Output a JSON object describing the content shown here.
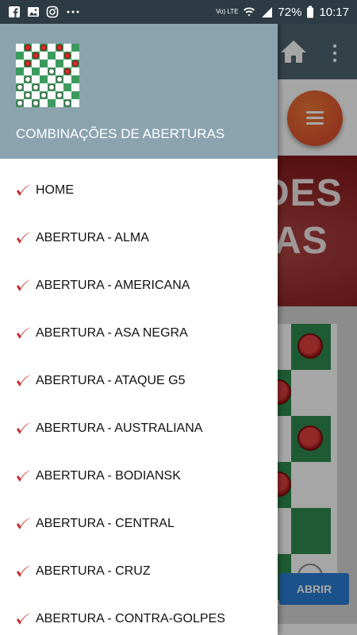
{
  "status_bar": {
    "left_icons": [
      "facebook-icon",
      "gallery-icon",
      "instagram-icon",
      "more-notifications-icon"
    ],
    "network": "Vo) LTE",
    "battery": "72%",
    "time": "10:17"
  },
  "background_app": {
    "banner_text_1": "DES",
    "banner_text_2": "AS",
    "open_button": "ABRIR"
  },
  "drawer": {
    "title": "COMBINAÇÕES DE ABERTURAS",
    "items": [
      {
        "label": "HOME"
      },
      {
        "label": "ABERTURA - ALMA"
      },
      {
        "label": "ABERTURA - AMERICANA"
      },
      {
        "label": "ABERTURA - ASA NEGRA"
      },
      {
        "label": "ABERTURA - ATAQUE G5"
      },
      {
        "label": "ABERTURA - AUSTRALIANA"
      },
      {
        "label": "ABERTURA - BODIANSK"
      },
      {
        "label": "ABERTURA - CENTRAL"
      },
      {
        "label": "ABERTURA - CRUZ"
      },
      {
        "label": "ABERTURA - CONTRA-GOLPES"
      }
    ]
  },
  "colors": {
    "status_bar": "#2d3b44",
    "drawer_header": "#8aa3af",
    "check_mark": "#c62828",
    "accent_fab": "#e0552f"
  }
}
